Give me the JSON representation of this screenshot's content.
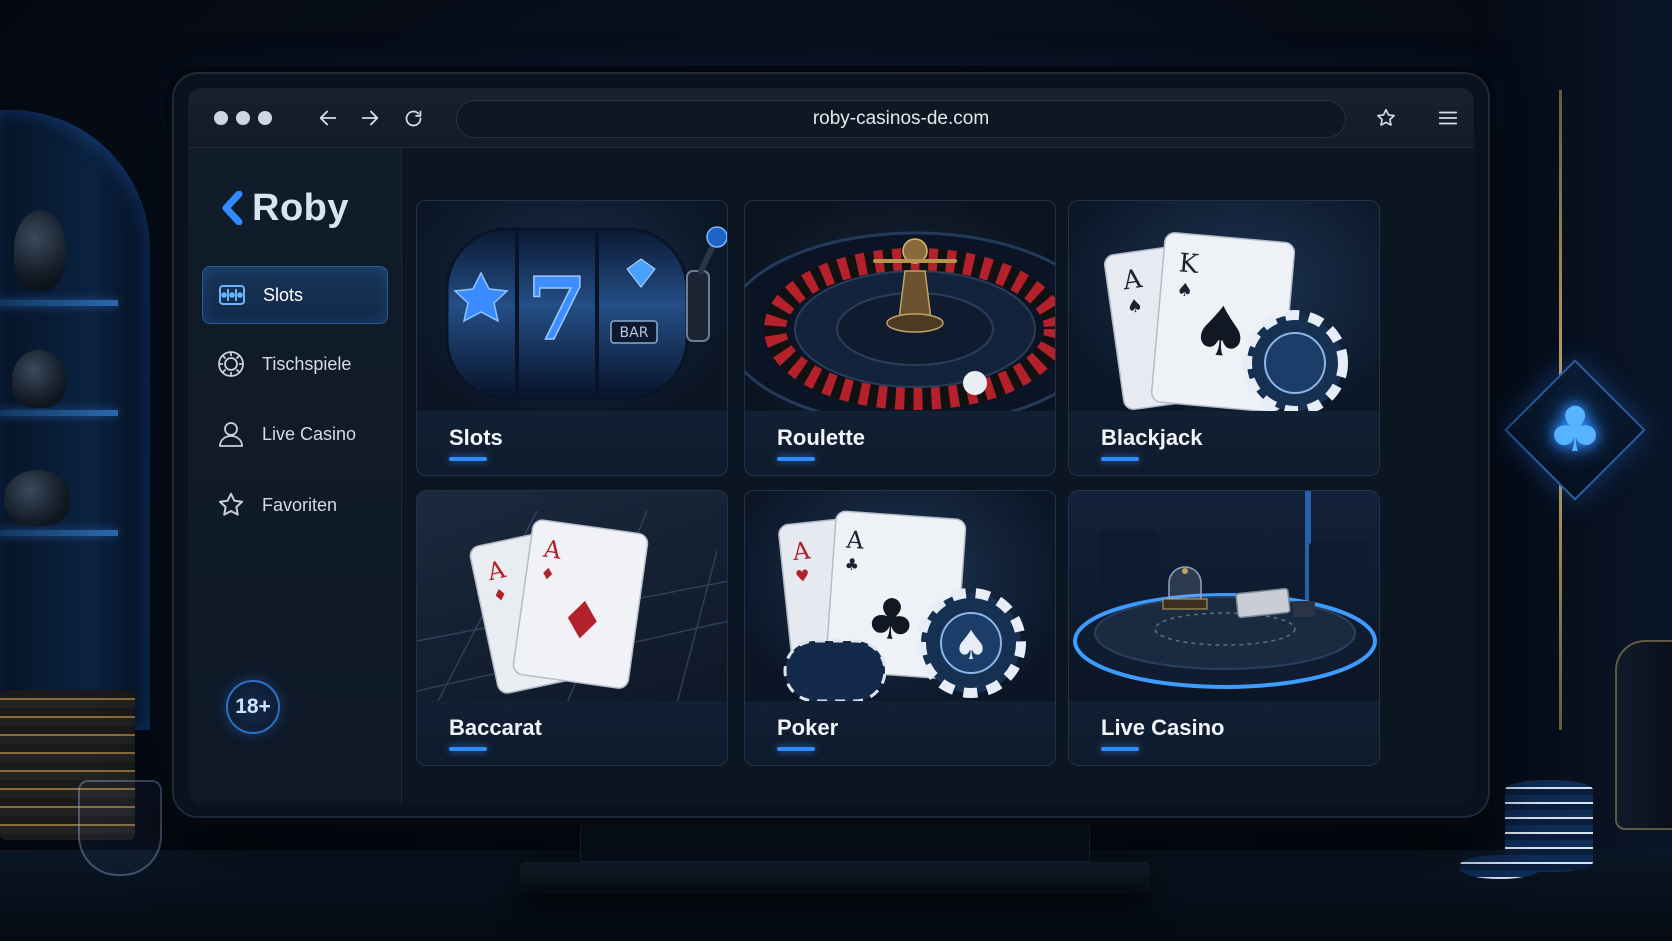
{
  "browser": {
    "url": "roby-casinos-de.com",
    "back_icon": "arrow-left-icon",
    "forward_icon": "arrow-right-icon",
    "reload_icon": "reload-icon",
    "bookmark_icon": "star-outline-icon",
    "menu_icon": "hamburger-menu-icon"
  },
  "sidebar": {
    "brand": "Roby",
    "items": [
      {
        "label": "Slots",
        "icon": "slot-machine-icon",
        "active": true
      },
      {
        "label": "Tischspiele",
        "icon": "roulette-wheel-icon",
        "active": false
      },
      {
        "label": "Live Casino",
        "icon": "user-icon",
        "active": false
      },
      {
        "label": "Favoriten",
        "icon": "star-outline-icon",
        "active": false
      }
    ],
    "age_badge": "18+"
  },
  "games": [
    {
      "label": "Slots",
      "art": "slot-machine-reels"
    },
    {
      "label": "Roulette",
      "art": "roulette-wheel"
    },
    {
      "label": "Blackjack",
      "art": "ace-king-spades-with-chip"
    },
    {
      "label": "Baccarat",
      "art": "ace-cards-on-table"
    },
    {
      "label": "Poker",
      "art": "ace-cards-with-chips"
    },
    {
      "label": "Live Casino",
      "art": "live-dealer-table"
    }
  ],
  "card_art_text": {
    "reel_seven": "7",
    "reel_bar": "BAR",
    "card_a": "A",
    "card_k": "K"
  },
  "colors": {
    "accent": "#2f8bff",
    "background": "#0c1623",
    "sidebar_active": "#173556"
  }
}
